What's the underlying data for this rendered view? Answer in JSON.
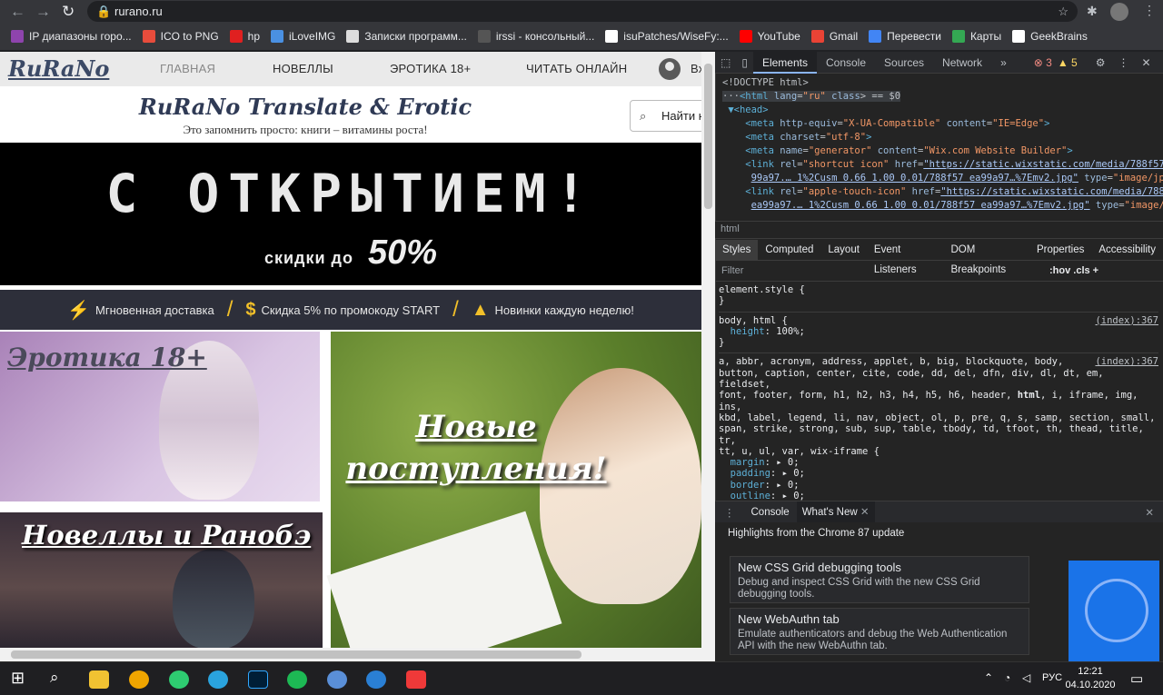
{
  "browser": {
    "url": "rurano.ru",
    "bookmarks": [
      {
        "label": "IP диапазоны горо...",
        "color": "#8e44ad"
      },
      {
        "label": "ICO to PNG",
        "color": "#e74c3c"
      },
      {
        "label": "hp",
        "color": "#e02020"
      },
      {
        "label": "iLoveIMG",
        "color": "#4a90e2"
      },
      {
        "label": "Записки программ...",
        "color": "#dddddd"
      },
      {
        "label": "irssi - консольный...",
        "color": "#555555"
      },
      {
        "label": "isuPatches/WiseFy:...",
        "color": "#ffffff"
      },
      {
        "label": "YouTube",
        "color": "#ff0000"
      },
      {
        "label": "Gmail",
        "color": "#ea4335"
      },
      {
        "label": "Перевести",
        "color": "#4285f4"
      },
      {
        "label": "Карты",
        "color": "#34a853"
      },
      {
        "label": "GeekBrains",
        "color": "#ffffff"
      }
    ]
  },
  "site": {
    "logo": "RuRaNo",
    "menu": [
      "ГЛАВНАЯ",
      "НОВЕЛЛЫ",
      "ЭРОТИКА 18+",
      "ЧИТАТЬ ОНЛАЙН"
    ],
    "user_label": "Вх",
    "title": "RuRaNo Translate & Erotic",
    "tagline": "Это запомнить просто: книги – витамины роста!",
    "search_placeholder": "Найти н",
    "banner_title": "С ОТКРЫТИЕМ!",
    "banner_sub_1": "скидки до",
    "banner_sub_2": "50%",
    "features": [
      "Мгновенная доставка",
      "Скидка 5% по промокоду START",
      "Новинки каждую неделю!"
    ],
    "tile1_title": "Эротика 18+",
    "tile2_title": "Новеллы и Ранобэ",
    "tile3_title_1": "Новые",
    "tile3_title_2": "поступления!"
  },
  "devtools": {
    "tabs": [
      "Elements",
      "Console",
      "Sources",
      "Network"
    ],
    "errors": "3",
    "warnings": "5",
    "breadcrumb": "html",
    "style_tabs": [
      "Styles",
      "Computed",
      "Layout",
      "Event Listeners",
      "DOM Breakpoints",
      "Properties",
      "Accessibility"
    ],
    "filter_placeholder": "Filter",
    "filter_tools": ":hov  .cls  +",
    "index_ref": "(index):367",
    "drawer_tabs": [
      "Console",
      "What's New"
    ],
    "highlights": "Highlights from the Chrome 87 update",
    "cards": [
      {
        "title": "New CSS Grid debugging tools",
        "desc": "Debug and inspect CSS Grid with the new CSS Grid debugging tools."
      },
      {
        "title": "New WebAuthn tab",
        "desc": "Emulate authenticators and debug the Web Authentication API with the new WebAuthn tab."
      }
    ]
  },
  "taskbar": {
    "lang": "РУС",
    "time": "12:21",
    "date": "04.10.2020"
  }
}
